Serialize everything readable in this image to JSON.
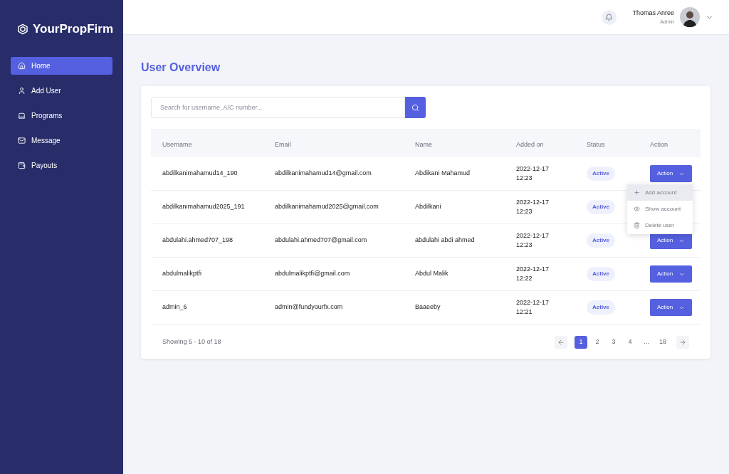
{
  "brand": "YourPropFirm",
  "sidebar": {
    "items": [
      {
        "label": "Home",
        "kind": "home",
        "selected": true
      },
      {
        "label": "Add User",
        "kind": "user",
        "selected": false
      },
      {
        "label": "Programs",
        "kind": "laptop",
        "selected": false
      },
      {
        "label": "Message",
        "kind": "mail",
        "selected": false
      },
      {
        "label": "Payouts",
        "kind": "wallet",
        "selected": false
      }
    ]
  },
  "header": {
    "user_name": "Thomas Anree",
    "user_role": "Admin"
  },
  "page_title": "User Overview",
  "search": {
    "placeholder": "Search for username, A/C number..."
  },
  "table": {
    "columns": [
      "Username",
      "Email",
      "Name",
      "Added on",
      "Status",
      "Action"
    ],
    "rows": [
      {
        "username": "abdilkanimahamud14_190",
        "email": "abdilkanimahamud14@gmail.com",
        "name": "Abdikani Mahamud",
        "date": "2022-12-17",
        "time": "12:23",
        "status": "Active",
        "action": "Action"
      },
      {
        "username": "abdilkanimahamud2025_191",
        "email": "abdilkanimahamud2025@gmail.com",
        "name": "Abdilkani",
        "date": "2022-12-17",
        "time": "12:23",
        "status": "Active"
      },
      {
        "username": "abdulahi.ahmed707_198",
        "email": "abdulahi.ahmed707@gmail.com",
        "name": "abdulahi abdi ahmed",
        "date": "2022-12-17",
        "time": "12:23",
        "status": "Active",
        "action": "Action"
      },
      {
        "username": "abdulmalikptfi",
        "email": "abdulmalikptfi@gmail.com",
        "name": "Abdul Malik",
        "date": "2022-12-17",
        "time": "12:22",
        "status": "Active",
        "action": "Action"
      },
      {
        "username": "admin_6",
        "email": "admin@fundyourfx.com",
        "name": "Baaeeby",
        "date": "2022-12-17",
        "time": "12:21",
        "status": "Active",
        "action": "Action"
      }
    ]
  },
  "action_menu": {
    "items": [
      {
        "label": "Add account",
        "kind": "add",
        "highlighted": true
      },
      {
        "label": "Show account",
        "kind": "view",
        "highlighted": false
      },
      {
        "label": "Delete user",
        "kind": "delete",
        "highlighted": false
      }
    ]
  },
  "footer": {
    "summary": "Showing 5 - 10 of 18",
    "pages": [
      {
        "label": "1",
        "selected": true
      },
      {
        "label": "2",
        "selected": false
      },
      {
        "label": "3",
        "selected": false
      },
      {
        "label": "4",
        "selected": false
      },
      {
        "label": "...",
        "selected": false
      },
      {
        "label": "18",
        "selected": false
      }
    ]
  }
}
